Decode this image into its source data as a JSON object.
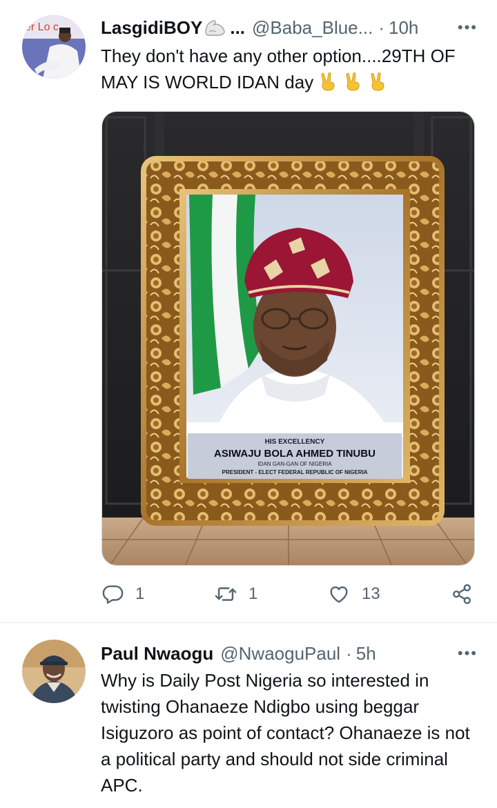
{
  "tweets": [
    {
      "display_name": "LasgidiBOY",
      "name_emoji": "flexed-biceps-emoji",
      "name_ellipsis": "...",
      "handle": "@Baba_Blue...",
      "separator": "·",
      "time": "10h",
      "more": "•••",
      "text": "They don't have any other option....29TH OF MAY IS WORLD IDAN day",
      "trailing_emoji": [
        "victory-hand-emoji",
        "victory-hand-emoji",
        "victory-hand-emoji"
      ],
      "avatar_text": "er Lo   c",
      "media": {
        "caption_line1": "HIS EXCELLENCY",
        "caption_line2": "ASIWAJU BOLA AHMED TINUBU",
        "caption_line3": "IDAN GAN-GAN OF NIGERIA",
        "caption_line4": "PRESIDENT - ELECT FEDERAL REPUBLIC OF NIGERIA"
      },
      "stats": {
        "replies": "1",
        "retweets": "1",
        "likes": "13"
      }
    },
    {
      "display_name": "Paul Nwaogu",
      "handle": "@NwaoguPaul",
      "separator": "·",
      "time": "5h",
      "more": "•••",
      "text": "Why is Daily Post Nigeria so interested in twisting Ohanaeze Ndigbo using beggar Isiguzoro as point of contact? Ohanaeze is not a political party and should not side criminal APC."
    }
  ],
  "icons": {
    "reply": "reply-icon",
    "retweet": "retweet-icon",
    "like": "heart-icon",
    "share": "share-icon"
  },
  "colors": {
    "text": "#0f1419",
    "secondary": "#536471",
    "divider": "#e6ecf0",
    "frame_gold": "#b8862e",
    "flag_green": "#1e9a46",
    "cap_red": "#9b1634"
  }
}
